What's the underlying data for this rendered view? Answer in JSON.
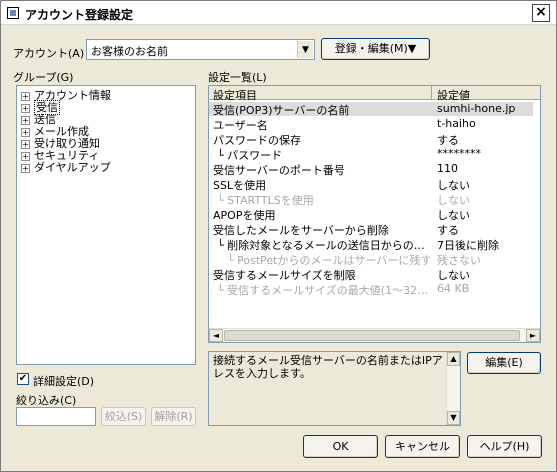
{
  "window": {
    "title": "アカウント登録設定",
    "close_label": "×"
  },
  "account": {
    "label": "アカウント(A)",
    "selected": "お客様のお名前",
    "menu_button": "登録・編集(M)▼"
  },
  "group": {
    "label": "グループ(G)",
    "items": [
      {
        "label": "アカウント情報",
        "expand": "+"
      },
      {
        "label": "受信",
        "expand": "+"
      },
      {
        "label": "送信",
        "expand": "+"
      },
      {
        "label": "メール作成",
        "expand": "+"
      },
      {
        "label": "受け取り通知",
        "expand": "+"
      },
      {
        "label": "セキュリティ",
        "expand": "+"
      },
      {
        "label": "ダイヤルアップ",
        "expand": "+"
      }
    ]
  },
  "settings": {
    "label": "設定一覧(L)",
    "columns": [
      "設定項目",
      "設定値"
    ],
    "rows": [
      {
        "item": "受信(POP3)サーバーの名前",
        "value": "sumhi-hone.jp"
      },
      {
        "item": "ユーザー名",
        "value": "t-haiho"
      },
      {
        "item": "パスワードの保存",
        "value": "する"
      },
      {
        "item": "└ パスワード",
        "value": "********"
      },
      {
        "item": "受信サーバーのポート番号",
        "value": "110"
      },
      {
        "item": "SSLを使用",
        "value": "しない"
      },
      {
        "item": "└ STARTTLSを使用",
        "value": "しない"
      },
      {
        "item": "APOPを使用",
        "value": "しない"
      },
      {
        "item": "受信したメールをサーバーから削除",
        "value": "する"
      },
      {
        "item": "└ 削除対象となるメールの送信日からの日...",
        "value": "7日後に削除"
      },
      {
        "item": "└ PostPetからのメールはサーバーに残す",
        "value": "残さない"
      },
      {
        "item": "受信するメールサイズを制限",
        "value": "しない"
      },
      {
        "item": "└ 受信するメールサイズの最大値(1～32767...",
        "value": "64 KB"
      }
    ],
    "description": "接続するメール受信サーバーの名前またはIPアドレスを入力します。",
    "edit_button": "編集(E)"
  },
  "options": {
    "detail_label": "詳細設定(D)",
    "detail_check": "✔",
    "filter_label": "絞り込み(C)",
    "filter_value": "",
    "filter_button": "絞込(S)",
    "clear_button": "解除(R)"
  },
  "footer": {
    "ok": "OK",
    "cancel": "キャンセル",
    "help": "ヘルプ(H)"
  },
  "icons": {
    "arrow_left": "◄",
    "arrow_right": "►",
    "arrow_up": "▲",
    "arrow_down": "▼"
  }
}
